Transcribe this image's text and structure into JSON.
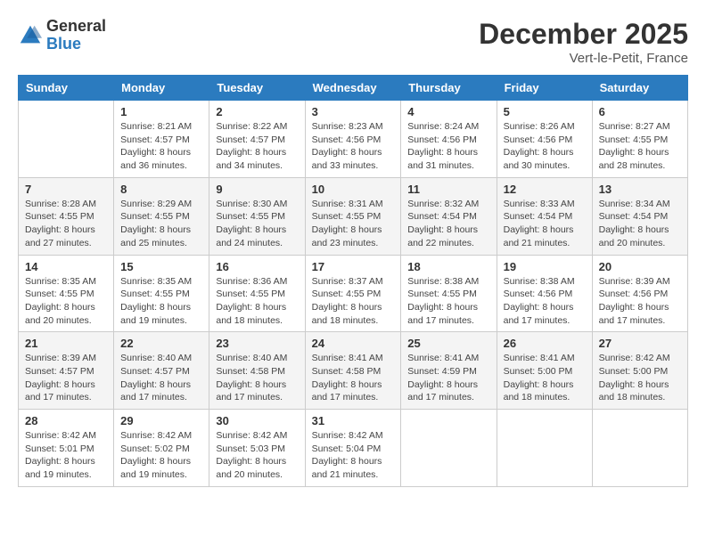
{
  "header": {
    "logo_general": "General",
    "logo_blue": "Blue",
    "month_title": "December 2025",
    "subtitle": "Vert-le-Petit, France"
  },
  "days_of_week": [
    "Sunday",
    "Monday",
    "Tuesday",
    "Wednesday",
    "Thursday",
    "Friday",
    "Saturday"
  ],
  "weeks": [
    [
      {
        "day": "",
        "info": ""
      },
      {
        "day": "1",
        "info": "Sunrise: 8:21 AM\nSunset: 4:57 PM\nDaylight: 8 hours\nand 36 minutes."
      },
      {
        "day": "2",
        "info": "Sunrise: 8:22 AM\nSunset: 4:57 PM\nDaylight: 8 hours\nand 34 minutes."
      },
      {
        "day": "3",
        "info": "Sunrise: 8:23 AM\nSunset: 4:56 PM\nDaylight: 8 hours\nand 33 minutes."
      },
      {
        "day": "4",
        "info": "Sunrise: 8:24 AM\nSunset: 4:56 PM\nDaylight: 8 hours\nand 31 minutes."
      },
      {
        "day": "5",
        "info": "Sunrise: 8:26 AM\nSunset: 4:56 PM\nDaylight: 8 hours\nand 30 minutes."
      },
      {
        "day": "6",
        "info": "Sunrise: 8:27 AM\nSunset: 4:55 PM\nDaylight: 8 hours\nand 28 minutes."
      }
    ],
    [
      {
        "day": "7",
        "info": "Sunrise: 8:28 AM\nSunset: 4:55 PM\nDaylight: 8 hours\nand 27 minutes."
      },
      {
        "day": "8",
        "info": "Sunrise: 8:29 AM\nSunset: 4:55 PM\nDaylight: 8 hours\nand 25 minutes."
      },
      {
        "day": "9",
        "info": "Sunrise: 8:30 AM\nSunset: 4:55 PM\nDaylight: 8 hours\nand 24 minutes."
      },
      {
        "day": "10",
        "info": "Sunrise: 8:31 AM\nSunset: 4:55 PM\nDaylight: 8 hours\nand 23 minutes."
      },
      {
        "day": "11",
        "info": "Sunrise: 8:32 AM\nSunset: 4:54 PM\nDaylight: 8 hours\nand 22 minutes."
      },
      {
        "day": "12",
        "info": "Sunrise: 8:33 AM\nSunset: 4:54 PM\nDaylight: 8 hours\nand 21 minutes."
      },
      {
        "day": "13",
        "info": "Sunrise: 8:34 AM\nSunset: 4:54 PM\nDaylight: 8 hours\nand 20 minutes."
      }
    ],
    [
      {
        "day": "14",
        "info": "Sunrise: 8:35 AM\nSunset: 4:55 PM\nDaylight: 8 hours\nand 20 minutes."
      },
      {
        "day": "15",
        "info": "Sunrise: 8:35 AM\nSunset: 4:55 PM\nDaylight: 8 hours\nand 19 minutes."
      },
      {
        "day": "16",
        "info": "Sunrise: 8:36 AM\nSunset: 4:55 PM\nDaylight: 8 hours\nand 18 minutes."
      },
      {
        "day": "17",
        "info": "Sunrise: 8:37 AM\nSunset: 4:55 PM\nDaylight: 8 hours\nand 18 minutes."
      },
      {
        "day": "18",
        "info": "Sunrise: 8:38 AM\nSunset: 4:55 PM\nDaylight: 8 hours\nand 17 minutes."
      },
      {
        "day": "19",
        "info": "Sunrise: 8:38 AM\nSunset: 4:56 PM\nDaylight: 8 hours\nand 17 minutes."
      },
      {
        "day": "20",
        "info": "Sunrise: 8:39 AM\nSunset: 4:56 PM\nDaylight: 8 hours\nand 17 minutes."
      }
    ],
    [
      {
        "day": "21",
        "info": "Sunrise: 8:39 AM\nSunset: 4:57 PM\nDaylight: 8 hours\nand 17 minutes."
      },
      {
        "day": "22",
        "info": "Sunrise: 8:40 AM\nSunset: 4:57 PM\nDaylight: 8 hours\nand 17 minutes."
      },
      {
        "day": "23",
        "info": "Sunrise: 8:40 AM\nSunset: 4:58 PM\nDaylight: 8 hours\nand 17 minutes."
      },
      {
        "day": "24",
        "info": "Sunrise: 8:41 AM\nSunset: 4:58 PM\nDaylight: 8 hours\nand 17 minutes."
      },
      {
        "day": "25",
        "info": "Sunrise: 8:41 AM\nSunset: 4:59 PM\nDaylight: 8 hours\nand 17 minutes."
      },
      {
        "day": "26",
        "info": "Sunrise: 8:41 AM\nSunset: 5:00 PM\nDaylight: 8 hours\nand 18 minutes."
      },
      {
        "day": "27",
        "info": "Sunrise: 8:42 AM\nSunset: 5:00 PM\nDaylight: 8 hours\nand 18 minutes."
      }
    ],
    [
      {
        "day": "28",
        "info": "Sunrise: 8:42 AM\nSunset: 5:01 PM\nDaylight: 8 hours\nand 19 minutes."
      },
      {
        "day": "29",
        "info": "Sunrise: 8:42 AM\nSunset: 5:02 PM\nDaylight: 8 hours\nand 19 minutes."
      },
      {
        "day": "30",
        "info": "Sunrise: 8:42 AM\nSunset: 5:03 PM\nDaylight: 8 hours\nand 20 minutes."
      },
      {
        "day": "31",
        "info": "Sunrise: 8:42 AM\nSunset: 5:04 PM\nDaylight: 8 hours\nand 21 minutes."
      },
      {
        "day": "",
        "info": ""
      },
      {
        "day": "",
        "info": ""
      },
      {
        "day": "",
        "info": ""
      }
    ]
  ]
}
